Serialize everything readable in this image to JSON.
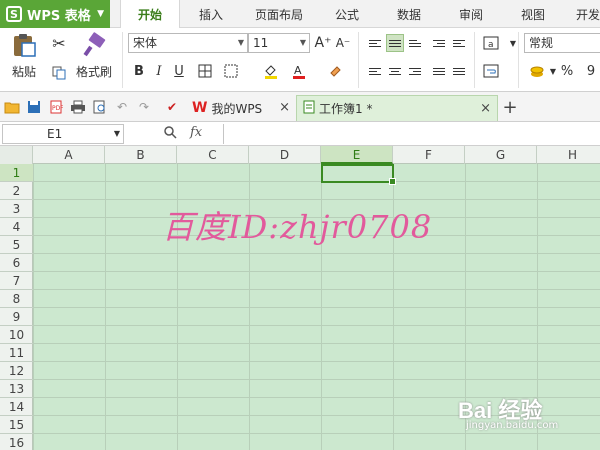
{
  "app": {
    "name": "WPS 表格",
    "logo_letter": "S"
  },
  "menu_tabs": [
    "开始",
    "插入",
    "页面布局",
    "公式",
    "数据",
    "审阅",
    "视图",
    "开发"
  ],
  "ribbon": {
    "paste_label": "粘贴",
    "format_painter_label": "格式刷",
    "font_name": "宋体",
    "font_size": "11",
    "number_format": "常规",
    "bold": "B",
    "italic": "I",
    "underline": "U",
    "percent": "%",
    "comma": "9"
  },
  "doc_tabs": [
    {
      "label": "我的WPS",
      "close": "×"
    },
    {
      "label": "工作簿1 *",
      "close": "×"
    }
  ],
  "new_tab": "+",
  "formula_bar": {
    "name_box": "E1",
    "fx": "fx",
    "value": ""
  },
  "sheet": {
    "columns": [
      "A",
      "B",
      "C",
      "D",
      "E",
      "F",
      "G",
      "H"
    ],
    "rows": [
      "1",
      "2",
      "3",
      "4",
      "5",
      "6",
      "7",
      "8",
      "9",
      "10",
      "11",
      "12",
      "13",
      "14",
      "15",
      "16"
    ],
    "selected_cell": "E1"
  },
  "watermark": "百度ID:zhjr0708",
  "baidu_logo": "Bai 经验",
  "baidu_url": "jingyan.baidu.com"
}
